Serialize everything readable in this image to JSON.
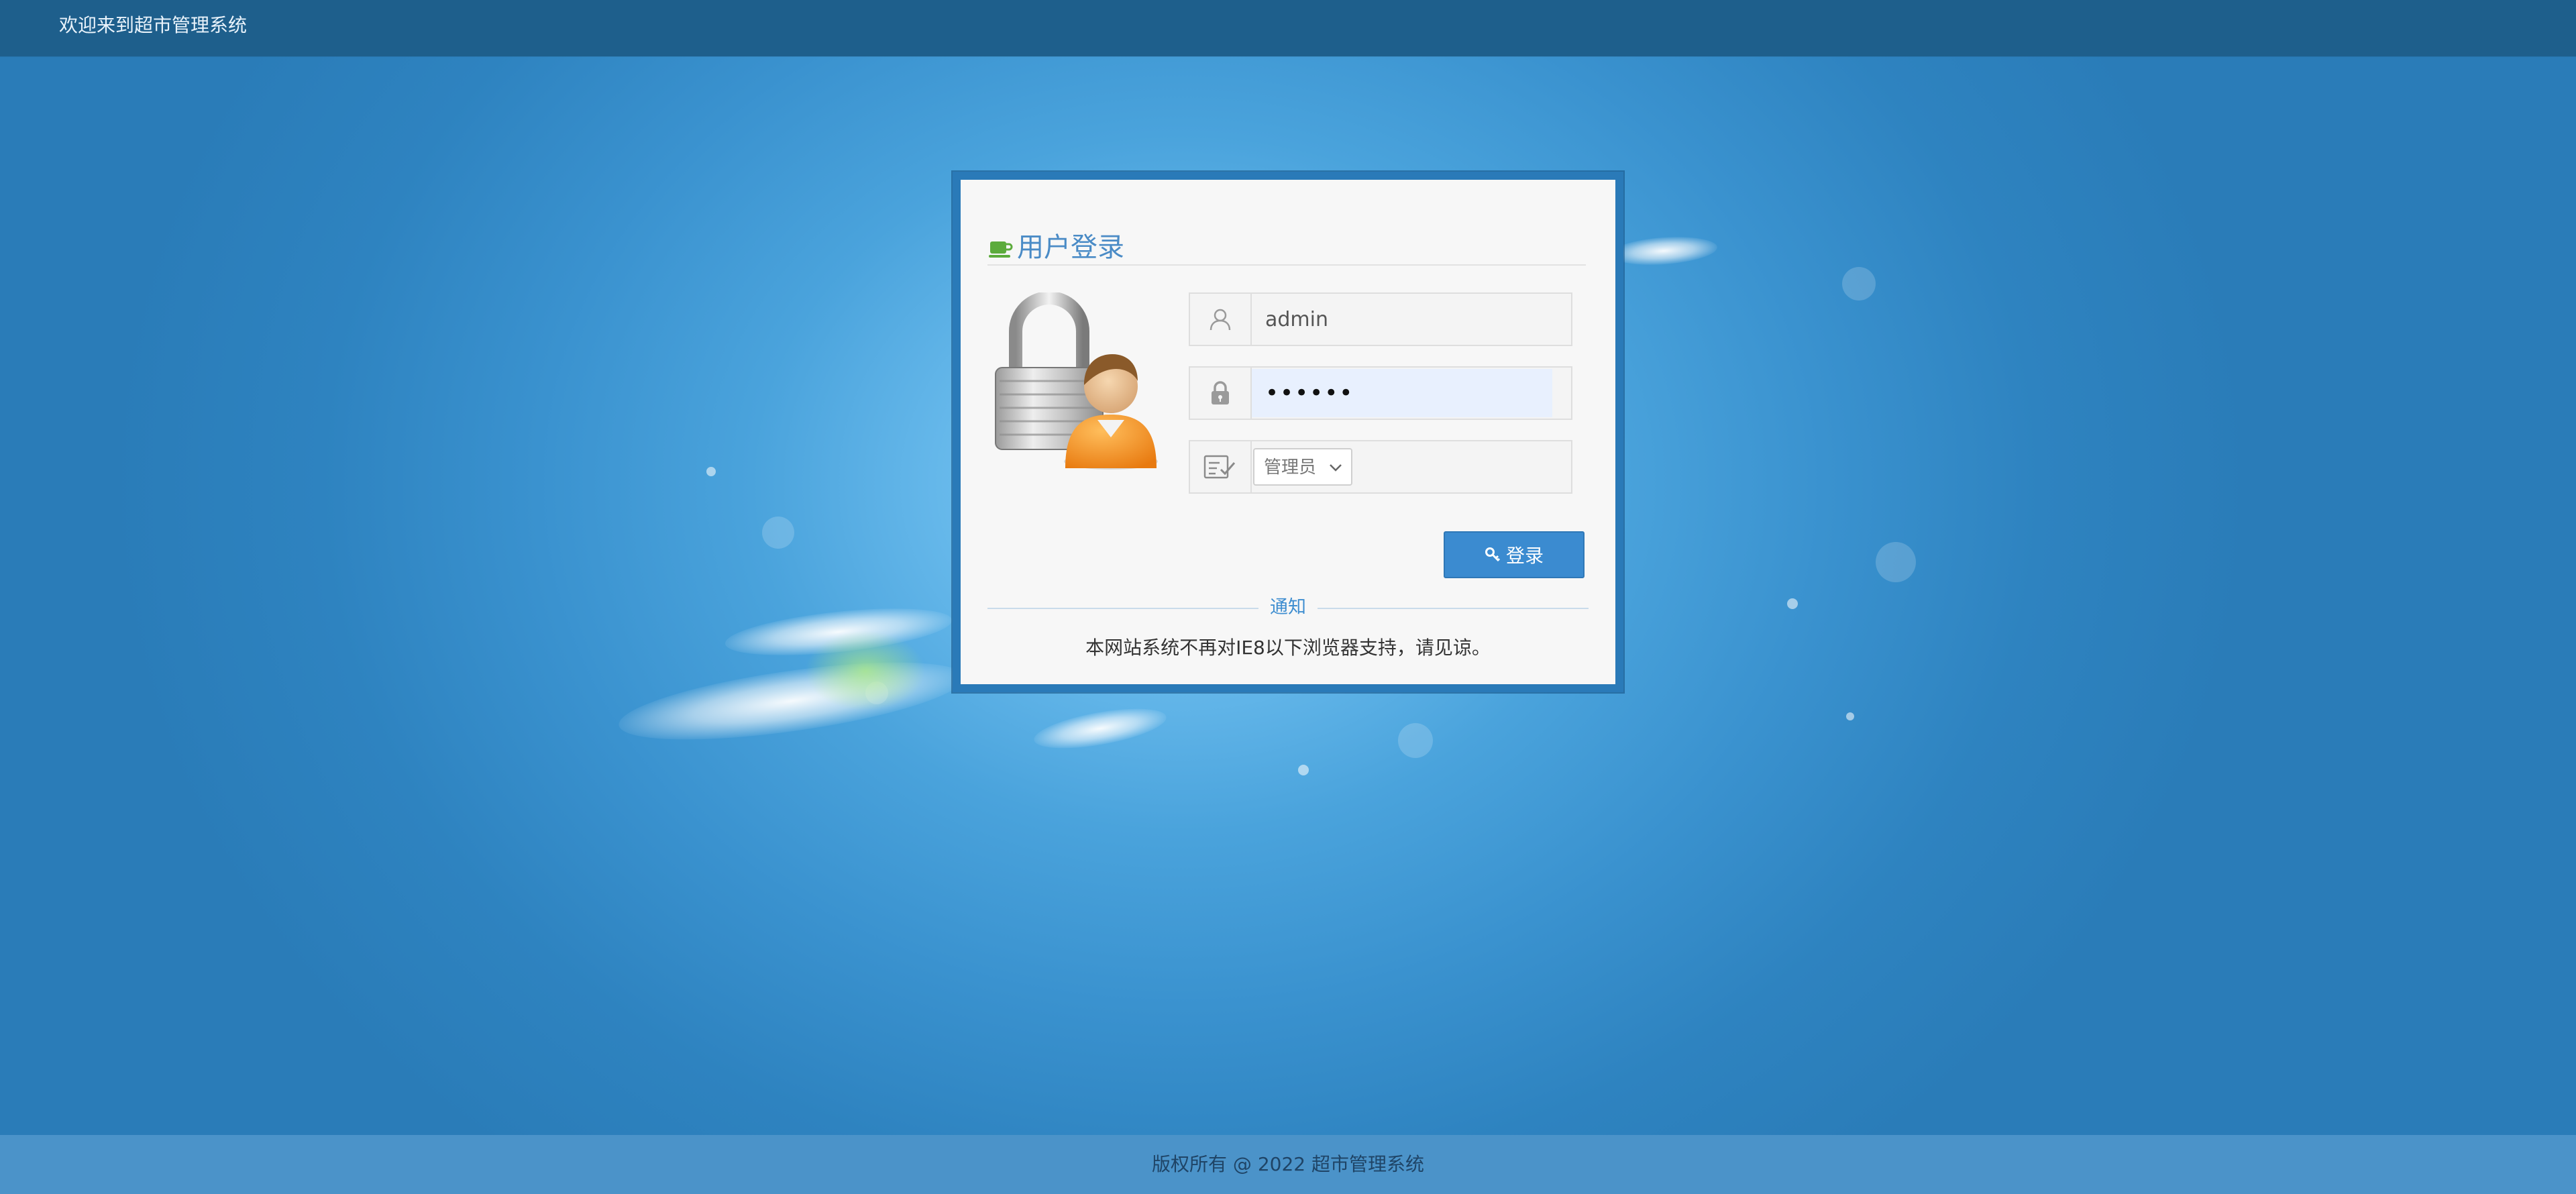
{
  "header": {
    "welcome_text": "欢迎来到超市管理系统"
  },
  "login": {
    "title": "用户登录",
    "username": {
      "value": "admin",
      "icon": "user-icon"
    },
    "password": {
      "value": "••••••",
      "icon": "lock-icon"
    },
    "role": {
      "selected": "管理员",
      "icon": "checklist-icon"
    },
    "submit_label": "登录",
    "submit_icon": "key-icon",
    "notice_label": "通知",
    "notice_text": "本网站系统不再对IE8以下浏览器支持，请见谅。"
  },
  "footer": {
    "copyright": "版权所有 @ 2022 超市管理系统"
  },
  "colors": {
    "topbar": "#1e5f8c",
    "panel_border": "#2a7ab8",
    "accent": "#4a8bc6",
    "button": "#3b8bd0",
    "footer": "#4b93c9"
  }
}
